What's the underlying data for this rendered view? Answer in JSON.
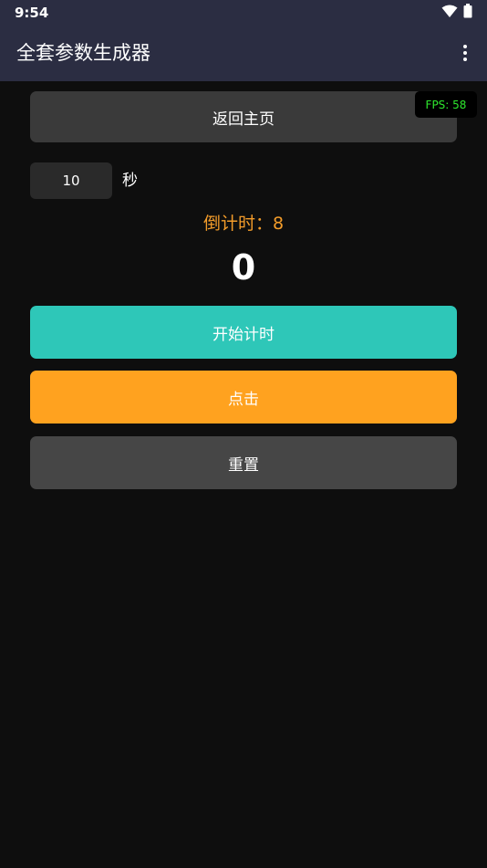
{
  "status_bar": {
    "time": "9:54"
  },
  "app_bar": {
    "title": "全套参数生成器"
  },
  "buttons": {
    "home": "返回主页",
    "start": "开始计时",
    "click": "点击",
    "reset": "重置"
  },
  "fps": "FPS: 58",
  "timer": {
    "seconds_value": "10",
    "unit": "秒",
    "countdown_label": "倒计时：",
    "countdown_value": "8",
    "click_count": "0"
  },
  "colors": {
    "app_bar_bg": "#2b2d42",
    "background": "#0e0e0e",
    "countdown_text": "#f39c2a",
    "start_button": "#2ec7b8",
    "click_button": "#ffa21f",
    "reset_button": "#464646",
    "fps_text": "#2ee82e"
  },
  "icons": {
    "wifi": "wifi-icon",
    "battery": "battery-icon",
    "overflow": "more-vert-icon"
  }
}
